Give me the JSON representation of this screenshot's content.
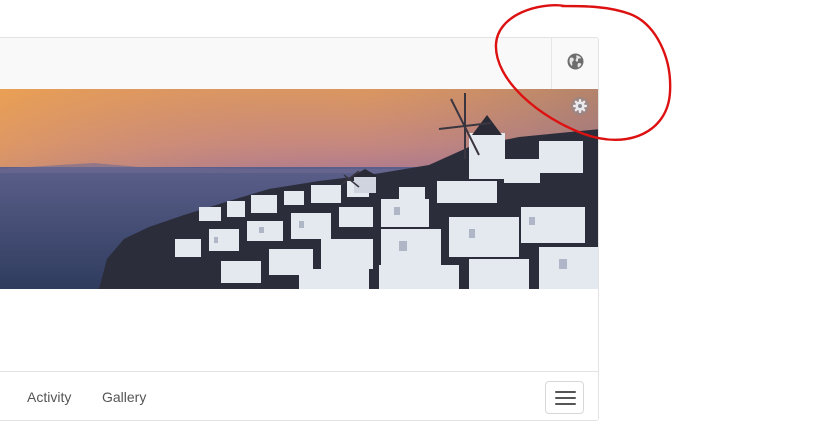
{
  "topbar": {
    "globe_icon": "globe-icon"
  },
  "cover": {
    "image": "santorini-sunset-cover-photo",
    "settings_icon": "gear-icon",
    "colors": {
      "sky_top": "#e39c55",
      "sky_mid": "#b8729a",
      "sky_low": "#5d5f8e",
      "sea": "#3b4a70",
      "buildings": "#e8ecf2"
    }
  },
  "nav": {
    "items": [
      {
        "label": "Activity"
      },
      {
        "label": "Gallery"
      }
    ],
    "menu_icon": "hamburger-icon"
  },
  "annotation": {
    "type": "hand-drawn red circle around globe icon",
    "color": "#dd1111"
  }
}
